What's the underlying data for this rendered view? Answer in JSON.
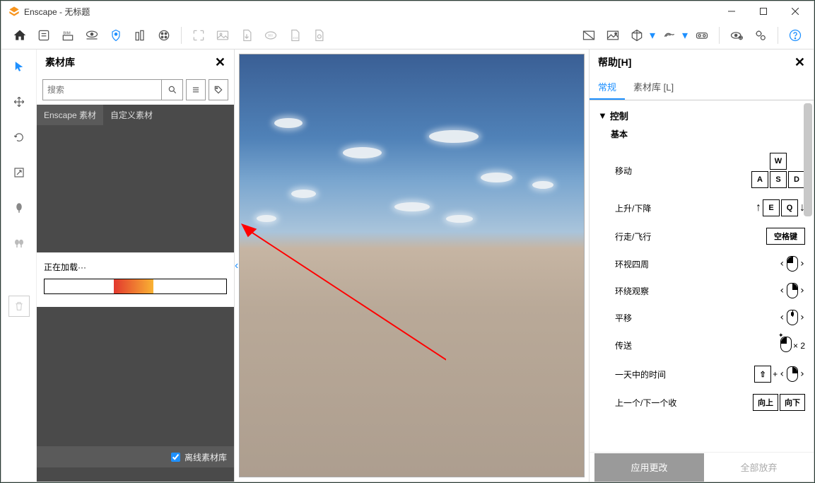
{
  "window": {
    "title": "Enscape - 无标题"
  },
  "matlib": {
    "title": "素材库",
    "search_placeholder": "搜索",
    "tab1": "Enscape 素材",
    "tab2": "自定义素材",
    "loading": "正在加载···",
    "offline": "离线素材库"
  },
  "help": {
    "title": "帮助[H]",
    "tab_general": "常规",
    "tab_matlib": "素材库 [L]",
    "section_control": "控制",
    "section_basic": "基本",
    "rows": {
      "move": "移动",
      "updown": "上升/下降",
      "walkfly": "行走/飞行",
      "look": "环视四周",
      "orbit": "环绕观察",
      "pan": "平移",
      "teleport": "传送",
      "timeofday": "一天中的时间",
      "prevnext": "上一个/下一个收"
    },
    "keys": {
      "w": "W",
      "a": "A",
      "s": "S",
      "d": "D",
      "e": "E",
      "q": "Q",
      "space": "空格键",
      "shift": "⇧",
      "x2": "× 2",
      "up": "向上",
      "down": "向下",
      "plus": "+"
    }
  },
  "footer": {
    "apply": "应用更改",
    "discard": "全部放弃"
  }
}
